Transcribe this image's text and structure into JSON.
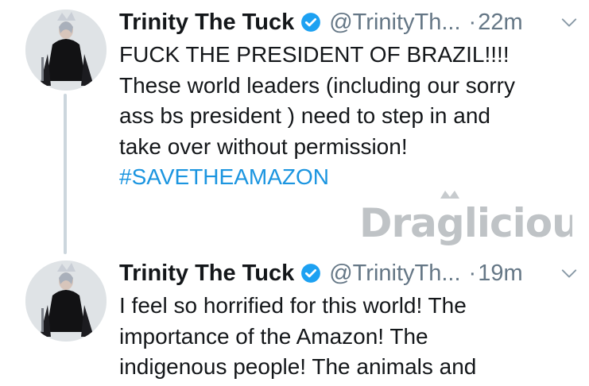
{
  "tweets": [
    {
      "display_name": "Trinity The Tuck",
      "handle": "@TrinityTh...",
      "separator": "·",
      "time": "22m",
      "lines": [
        "FUCK THE PRESIDENT OF BRAZIL!!!!",
        "These world leaders (including our sorry",
        "ass bs president ) need to step in and",
        "take over without permission!"
      ],
      "hashtag": "#SAVETHEAMAZON"
    },
    {
      "display_name": "Trinity The Tuck",
      "handle": "@TrinityTh...",
      "separator": "·",
      "time": "19m",
      "lines": [
        "I feel so horrified for this world! The",
        "importance of the Amazon! The",
        "indigenous people! The animals and"
      ]
    }
  ],
  "watermark": {
    "text": "Draglicious"
  },
  "colors": {
    "link": "#1b95e0",
    "secondary": "#657786",
    "verified": "#1da1f2",
    "thread_line": "#ccd6dd"
  },
  "icons": {
    "verified": "verified-badge-icon",
    "caret": "chevron-down-icon"
  }
}
